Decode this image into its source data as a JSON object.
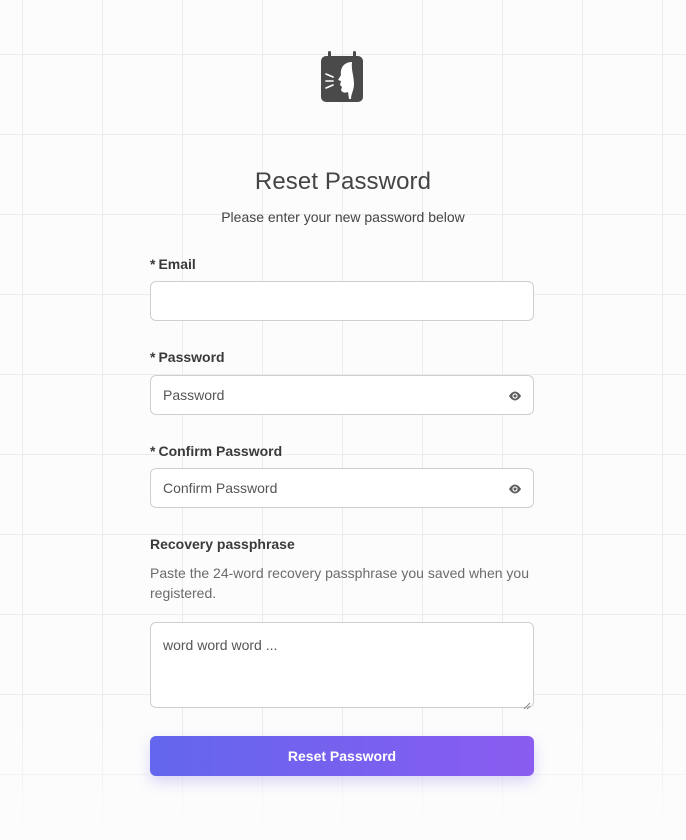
{
  "header": {
    "logo_icon": "notebook-profile-logo-icon",
    "title": "Reset Password",
    "subtitle": "Please enter your new password below"
  },
  "form": {
    "required_marker": "*",
    "email": {
      "label": "Email",
      "value": "",
      "placeholder": ""
    },
    "password": {
      "label": "Password",
      "placeholder": "Password",
      "toggle_icon": "eye-icon"
    },
    "confirm_password": {
      "label": "Confirm Password",
      "placeholder": "Confirm Password",
      "toggle_icon": "eye-icon"
    },
    "recovery": {
      "label": "Recovery passphrase",
      "help": "Paste the 24-word recovery passphrase you saved when you registered.",
      "placeholder": "word word word ..."
    },
    "submit_label": "Reset Password"
  },
  "colors": {
    "accent_start": "#6366ee",
    "accent_end": "#8a5cf0",
    "text": "#3d3d3d",
    "logo": "#4a4a4a"
  }
}
